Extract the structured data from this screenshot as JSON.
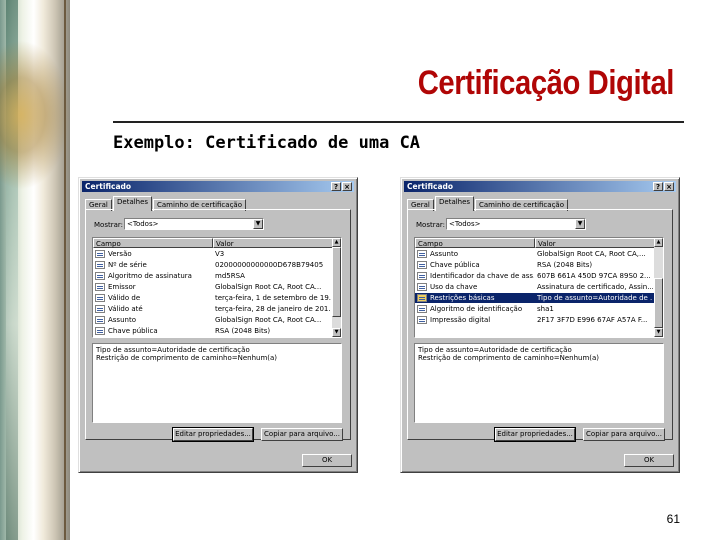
{
  "slide": {
    "title": "Certificação Digital",
    "subtitle": "Exemplo: Certificado de uma CA",
    "page_number": "61"
  },
  "dialog_left": {
    "title": "Certificado",
    "help_btn": "?",
    "close_btn": "×",
    "tabs": [
      "Geral",
      "Detalhes",
      "Caminho de certificação"
    ],
    "show_label": "Mostrar:",
    "show_value": "<Todos>",
    "columns": [
      "Campo",
      "Valor"
    ],
    "rows": [
      {
        "field": "Versão",
        "value": "V3"
      },
      {
        "field": "Nº de série",
        "value": "02000000000000D678B79405"
      },
      {
        "field": "Algoritmo de assinatura",
        "value": "md5RSA"
      },
      {
        "field": "Emissor",
        "value": "GlobalSign Root CA, Root CA..."
      },
      {
        "field": "Válido de",
        "value": "terça-feira, 1 de setembro de 19..."
      },
      {
        "field": "Válido até",
        "value": "terça-feira, 28 de janeiro de 201..."
      },
      {
        "field": "Assunto",
        "value": "GlobalSign Root CA, Root CA..."
      },
      {
        "field": "Chave pública",
        "value": "RSA (2048 Bits)"
      }
    ],
    "details_line1": "Tipo de assunto=Autoridade de certificação",
    "details_line2": "Restrição de comprimento de caminho=Nenhum(a)",
    "edit_button": "Editar propriedades...",
    "copy_button": "Copiar para arquivo...",
    "ok_button": "OK"
  },
  "dialog_right": {
    "title": "Certificado",
    "help_btn": "?",
    "close_btn": "×",
    "tabs": [
      "Geral",
      "Detalhes",
      "Caminho de certificação"
    ],
    "show_label": "Mostrar:",
    "show_value": "<Todos>",
    "columns": [
      "Campo",
      "Valor"
    ],
    "rows": [
      {
        "field": "Assunto",
        "value": "GlobalSign Root CA, Root CA,..."
      },
      {
        "field": "Chave pública",
        "value": "RSA (2048 Bits)"
      },
      {
        "field": "Identificador da chave de ass...",
        "value": "607B 661A 450D 97CA 89S0 2..."
      },
      {
        "field": "Uso da chave",
        "value": "Assinatura de certificado, Assin..."
      },
      {
        "field": "Restrições básicas",
        "value": "Tipo de assunto=Autoridade de ..."
      },
      {
        "field": "Algoritmo de identificação",
        "value": "sha1"
      },
      {
        "field": "Impressão digital",
        "value": "2F17 3F7D E996 67AF A57A F..."
      }
    ],
    "selected_row": 4,
    "details_line1": "Tipo de assunto=Autoridade de certificação",
    "details_line2": "Restrição de comprimento de caminho=Nenhum(a)",
    "edit_button": "Editar propriedades...",
    "copy_button": "Copiar para arquivo...",
    "ok_button": "OK"
  }
}
